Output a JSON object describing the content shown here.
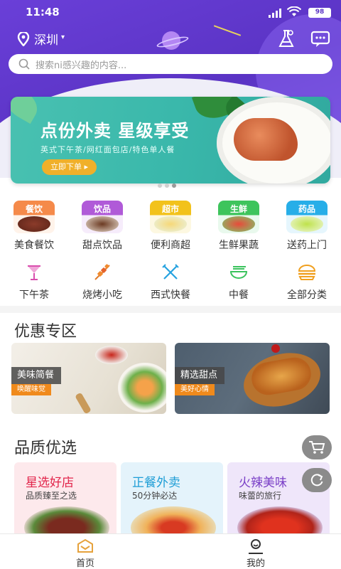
{
  "status": {
    "time": "11:48",
    "battery": "98"
  },
  "location": {
    "city": "深圳"
  },
  "search": {
    "placeholder": "搜索ni感兴趣的内容..."
  },
  "banner": {
    "title": "点份外卖  星级享受",
    "subtitle": "英式下午茶/网红面包店/特色单人餐",
    "button": "立即下单 ▸",
    "page_count": 3,
    "active_page": 3
  },
  "categories_main": [
    {
      "tag": "餐饮",
      "label": "美食餐饮",
      "color": "#f58a4a"
    },
    {
      "tag": "饮品",
      "label": "甜点饮品",
      "color": "#b05ad8"
    },
    {
      "tag": "超市",
      "label": "便利商超",
      "color": "#f2c21b"
    },
    {
      "tag": "生鲜",
      "label": "生鲜果蔬",
      "color": "#3ec45c"
    },
    {
      "tag": "药品",
      "label": "送药上门",
      "color": "#27aee8"
    }
  ],
  "categories_sub": [
    {
      "label": "下午茶",
      "icon": "cocktail-icon"
    },
    {
      "label": "烧烤小吃",
      "icon": "skewer-icon"
    },
    {
      "label": "西式快餐",
      "icon": "fork-knife-icon"
    },
    {
      "label": "中餐",
      "icon": "bowl-icon"
    },
    {
      "label": "全部分类",
      "icon": "burger-icon"
    }
  ],
  "promo_section": {
    "title": "优惠专区",
    "cards": [
      {
        "title": "美味简餐",
        "subtitle": "唤醒味觉"
      },
      {
        "title": "精选甜点",
        "subtitle": "美好心情"
      }
    ]
  },
  "quality_section": {
    "title": "品质优选",
    "cards": [
      {
        "title": "星选好店",
        "subtitle": "品质臻至之选",
        "title_color": "#e2244a",
        "bg": "#fde9ec"
      },
      {
        "title": "正餐外卖",
        "subtitle": "50分钟必达",
        "title_color": "#1f9ed6",
        "bg": "#e4f3fb"
      },
      {
        "title": "火辣美味",
        "subtitle": "味蕾的旅行",
        "title_color": "#7a3fc7",
        "bg": "#efe6fa"
      }
    ]
  },
  "tabbar": [
    {
      "label": "首页",
      "active": true,
      "color": "#e6a23c"
    },
    {
      "label": "我的",
      "active": false,
      "color": "#333333"
    }
  ]
}
